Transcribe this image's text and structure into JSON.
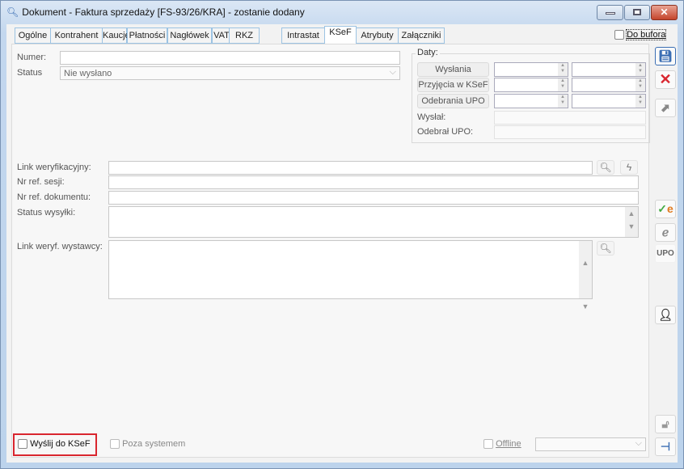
{
  "window": {
    "title": "Dokument - Faktura sprzedaży [FS-93/26/KRA]  - zostanie dodany",
    "close_glyph": "✕"
  },
  "tabs": [
    "Ogólne",
    "Kontrahent",
    "Kaucje",
    "Płatności",
    "Nagłówek",
    "VAT",
    "RKZ",
    "Intrastat",
    "KSeF",
    "Atrybuty",
    "Załączniki"
  ],
  "active_tab": "KSeF",
  "do_bufora": {
    "label": "Do bufora",
    "checked": false
  },
  "form": {
    "numer_label": "Numer:",
    "numer_value": "",
    "status_label": "Status",
    "status_value": "Nie wysłano",
    "link_weryf_label": "Link weryfikacyjny:",
    "nr_ref_sesji_label": "Nr ref. sesji:",
    "nr_ref_dok_label": "Nr ref. dokumentu:",
    "status_wysylki_label": "Status wysyłki:",
    "link_wystawcy_label": "Link weryf. wystawcy:"
  },
  "daty": {
    "title": "Daty:",
    "wyslania": "Wysłania",
    "przyjecia": "Przyjęcia w KSeF",
    "odebrania": "Odebrania UPO",
    "wyslal": "Wysłał:",
    "odebral": "Odebrał UPO:"
  },
  "bottom": {
    "wyslij": "Wyślij do KSeF",
    "poza": "Poza systemem",
    "offline": "Offline",
    "offline_value": ""
  },
  "toolbar": {
    "upo": "UPO",
    "e": "e"
  },
  "colors": {
    "highlight": "#d9262f",
    "accent": "#3c6fb4"
  }
}
